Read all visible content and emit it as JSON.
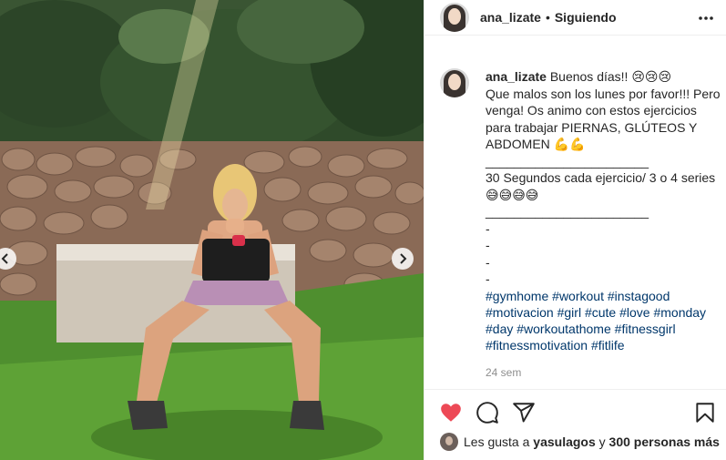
{
  "post": {
    "username": "ana_lizate",
    "separator": "•",
    "follow_label": "Siguiendo",
    "more_icon": "more-horizontal-icon"
  },
  "caption": {
    "username": "ana_lizate",
    "text": "Buenos días!! 😢😢😢\nQue malos son los lunes por favor!!! Pero venga! Os animo con estos ejercicios para trabajar PIERNAS, GLÚTEOS Y ABDOMEN 💪💪\n_______________________\n30 Segundos cada ejercicio/ 3 o 4 series 😅😅😅😅\n_______________________\n-\n-\n-\n-",
    "hashtags": [
      "#gymhome",
      "#workout",
      "#instagood",
      "#motivacion",
      "#girl",
      "#cute",
      "#love",
      "#monday",
      "#day",
      "#workoutathome",
      "#fitnessgirl",
      "#fitnessmotivation",
      "#fitlife"
    ],
    "time_ago": "24 sem"
  },
  "actions": {
    "like_icon": "heart-filled-icon",
    "comment_icon": "comment-icon",
    "share_icon": "share-icon",
    "save_icon": "bookmark-icon",
    "like_color": "#ed4956"
  },
  "likes": {
    "prefix": "Les gusta a",
    "first_user": "yasulagos",
    "conjunction": "y",
    "others": "300 personas más"
  },
  "colors": {
    "link": "#00376b",
    "muted": "#8e8e8e",
    "border": "#efefef"
  }
}
